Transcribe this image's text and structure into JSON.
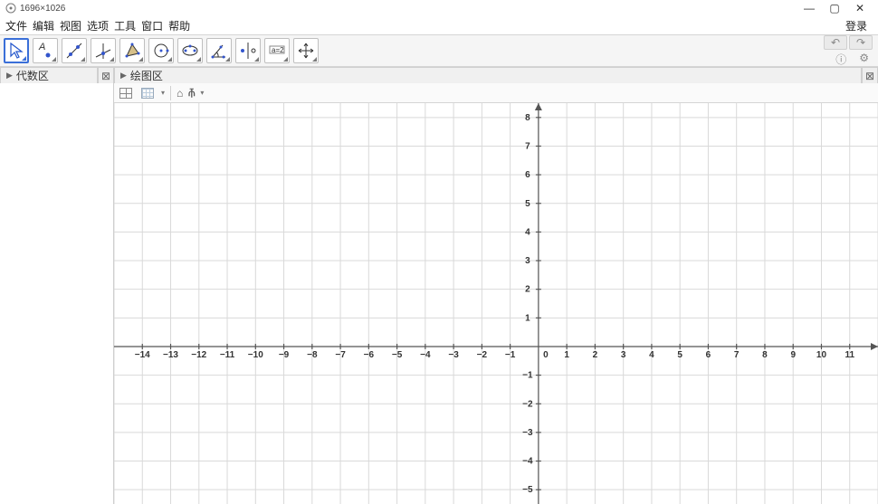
{
  "titlebar": {
    "dims": "1696×1026"
  },
  "menu": {
    "file": "文件",
    "edit": "编辑",
    "view": "视图",
    "options": "选项",
    "tools": "工具",
    "window": "窗口",
    "help": "帮助",
    "login": "登录"
  },
  "panels": {
    "algebra": "代数区",
    "graphics": "绘图区"
  },
  "toolbar": {
    "undo": "↶",
    "redo": "↷",
    "tools": [
      {
        "name": "move-tool"
      },
      {
        "name": "point-tool"
      },
      {
        "name": "line-tool"
      },
      {
        "name": "perpendicular-tool"
      },
      {
        "name": "polygon-tool"
      },
      {
        "name": "circle-tool"
      },
      {
        "name": "ellipse-tool"
      },
      {
        "name": "angle-tool"
      },
      {
        "name": "reflect-tool"
      },
      {
        "name": "slider-tool"
      },
      {
        "name": "move-view-tool"
      }
    ]
  },
  "chart_data": {
    "type": "coordinate-plane",
    "title": "",
    "xlabel": "",
    "ylabel": "",
    "x": {
      "min": -15,
      "max": 12,
      "ticks": [
        -14,
        -13,
        -12,
        -11,
        -10,
        -9,
        -8,
        -7,
        -6,
        -5,
        -4,
        -3,
        -2,
        -1,
        0,
        1,
        2,
        3,
        4,
        5,
        6,
        7,
        8,
        9,
        10,
        11
      ]
    },
    "y": {
      "min": -5.5,
      "max": 8.5,
      "ticks": [
        -5,
        -4,
        -3,
        -2,
        -1,
        1,
        2,
        3,
        4,
        5,
        6,
        7,
        8
      ]
    },
    "origin_label": "0",
    "grid": true,
    "series": []
  }
}
